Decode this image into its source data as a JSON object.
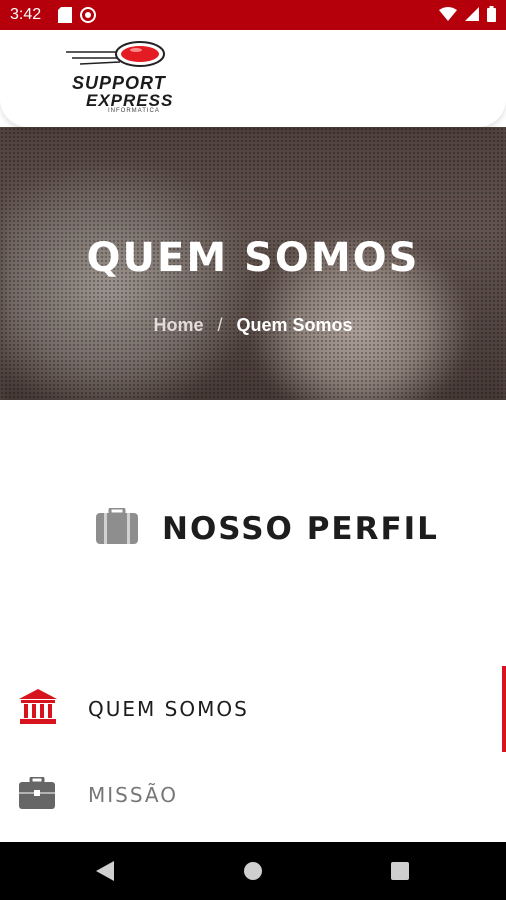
{
  "status_bar": {
    "time": "3:42",
    "left_icons": [
      "sd-card-icon",
      "sync-icon"
    ],
    "right_icons": [
      "wifi-icon",
      "signal-icon",
      "battery-icon"
    ]
  },
  "header": {
    "logo": {
      "line1": "SUPPORT",
      "line2": "EXPRESS",
      "line3": "INFORMATICA"
    }
  },
  "hero": {
    "title": "QUEM SOMOS",
    "breadcrumb": {
      "home": "Home",
      "separator": "/",
      "current": "Quem Somos"
    }
  },
  "section": {
    "icon": "briefcase-icon",
    "title": "NOSSO PERFIL"
  },
  "tabs": [
    {
      "label": "QUEM SOMOS",
      "icon": "bank-icon",
      "active": true
    },
    {
      "label": "MISSÃO",
      "icon": "briefcase-icon",
      "active": false
    }
  ],
  "navbar": {
    "buttons": [
      "back-icon",
      "home-icon",
      "recents-icon"
    ]
  },
  "colors": {
    "brand_red": "#b5000b",
    "accent_red": "#d7141d",
    "text_dark": "#1d1d1d",
    "muted_gray": "#777777"
  }
}
